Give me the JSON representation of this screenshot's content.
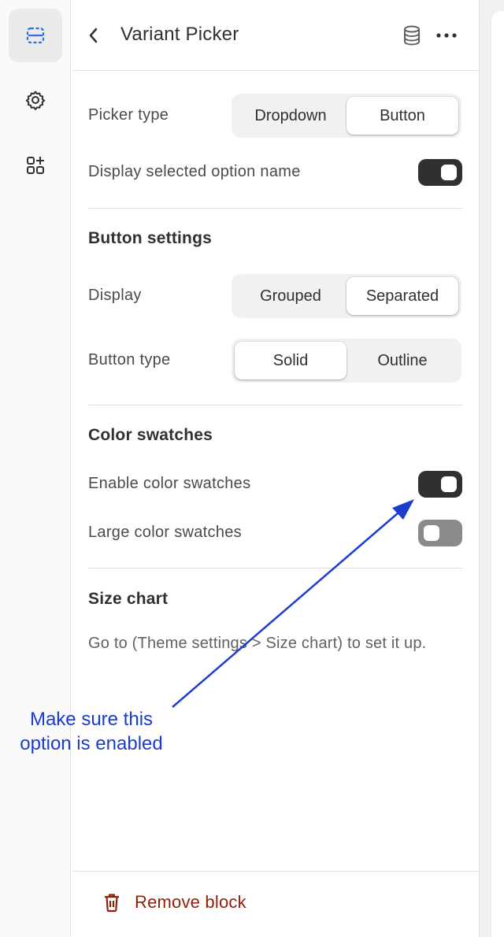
{
  "header": {
    "title": "Variant Picker",
    "back_icon": "chevron-left-icon",
    "database_icon": "database-icon",
    "more_icon": "more-horizontal-icon"
  },
  "rail": {
    "items": [
      {
        "icon": "sections-icon",
        "active": true
      },
      {
        "icon": "gear-icon",
        "active": false
      },
      {
        "icon": "apps-add-icon",
        "active": false
      }
    ]
  },
  "settings": {
    "picker_type": {
      "label": "Picker type",
      "options": [
        "Dropdown",
        "Button"
      ],
      "selected": "Button"
    },
    "display_selected_option_name": {
      "label": "Display selected option name",
      "enabled": true
    },
    "button_settings": {
      "heading": "Button settings",
      "display": {
        "label": "Display",
        "options": [
          "Grouped",
          "Separated"
        ],
        "selected": "Separated"
      },
      "button_type": {
        "label": "Button type",
        "options": [
          "Solid",
          "Outline"
        ],
        "selected": "Solid"
      }
    },
    "color_swatches": {
      "heading": "Color swatches",
      "enable": {
        "label": "Enable color swatches",
        "enabled": true
      },
      "large": {
        "label": "Large color swatches",
        "enabled": false
      }
    },
    "size_chart": {
      "heading": "Size chart",
      "help": "Go to (Theme settings > Size chart) to set it up."
    }
  },
  "footer": {
    "remove_label": "Remove block",
    "remove_icon": "trash-icon"
  },
  "annotation": {
    "line1": "Make sure this",
    "line2": "option is enabled",
    "color": "#1b3ccf"
  },
  "colors": {
    "accent_blue": "#1b3ccf",
    "toggle_on": "#303030",
    "toggle_off": "#8a8a8a",
    "danger": "#8e1f0b"
  }
}
